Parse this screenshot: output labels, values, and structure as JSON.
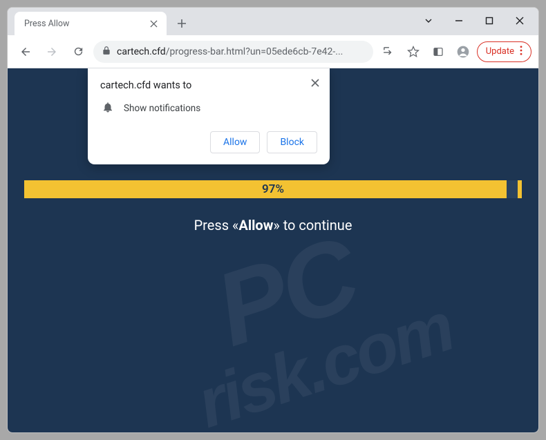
{
  "tab": {
    "title": "Press Allow"
  },
  "address": {
    "host": "cartech.cfd",
    "path": "/progress-bar.html?un=05ede6cb-7e42-..."
  },
  "toolbar": {
    "update_label": "Update"
  },
  "permission": {
    "title": "cartech.cfd wants to",
    "item": "Show notifications",
    "allow": "Allow",
    "block": "Block"
  },
  "page": {
    "progress_text": "97%",
    "progress_value": 97,
    "instruction_pre": "Press «",
    "instruction_bold": "Allow",
    "instruction_post": "» to continue"
  },
  "watermark": {
    "line1": "PC",
    "line2": "risk.com"
  }
}
